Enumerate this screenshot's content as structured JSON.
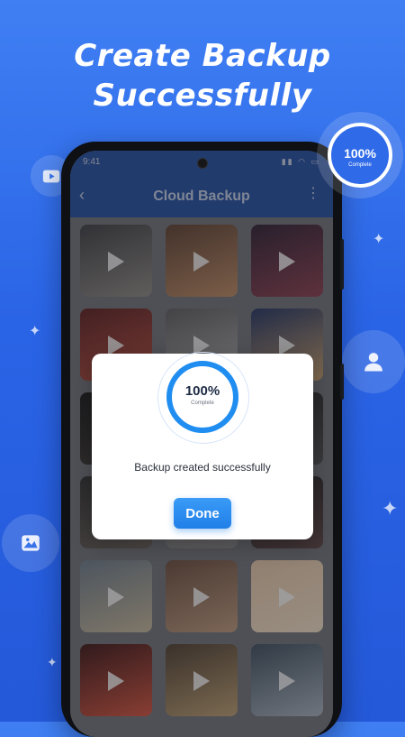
{
  "headline": {
    "line1": "Create Backup",
    "line2": "Successfully"
  },
  "badge": {
    "percent": "100%",
    "label": "Complete",
    "progress": 1.0
  },
  "status_bar": {
    "time": "9:41",
    "icons": "▮▮ ◠ ▭"
  },
  "app_bar": {
    "title": "Cloud Backup",
    "back_icon": "‹",
    "more_icon": "⋮"
  },
  "gallery": {
    "tiles": [
      {
        "name": "photographer",
        "colors": [
          "#3a3a3e",
          "#8e8a84"
        ]
      },
      {
        "name": "musician",
        "colors": [
          "#5a3c2c",
          "#c08a60"
        ]
      },
      {
        "name": "concert-crowd",
        "colors": [
          "#2a1a2e",
          "#8a3a4a"
        ]
      },
      {
        "name": "theater-seats",
        "colors": [
          "#5a1a1a",
          "#b84a3a"
        ]
      },
      {
        "name": "bw-portrait",
        "colors": [
          "#5a5a5a",
          "#b0b0b0"
        ]
      },
      {
        "name": "sunset-sky",
        "colors": [
          "#1e2f5e",
          "#c9a06a"
        ]
      },
      {
        "name": "dark-scene",
        "colors": [
          "#111",
          "#3a3530"
        ]
      },
      {
        "name": "hidden-1",
        "colors": [
          "#777",
          "#888"
        ]
      },
      {
        "name": "dark-scene-2",
        "colors": [
          "#1a1a1a",
          "#4a4a4a"
        ]
      },
      {
        "name": "beach-silhouette",
        "colors": [
          "#2a2a2a",
          "#6a6058"
        ]
      },
      {
        "name": "hidden-2",
        "colors": [
          "#777",
          "#888"
        ]
      },
      {
        "name": "couple-dusk",
        "colors": [
          "#1a1a1a",
          "#5a4040"
        ]
      },
      {
        "name": "picnic-lake",
        "colors": [
          "#6a7a88",
          "#c8b89a"
        ]
      },
      {
        "name": "couple-closeup",
        "colors": [
          "#6a4a3a",
          "#c09a7a"
        ]
      },
      {
        "name": "couple-dance",
        "colors": [
          "#e8c8a8",
          "#f5e2c8"
        ]
      },
      {
        "name": "red-sunset-couple",
        "colors": [
          "#3a1010",
          "#d8503a"
        ]
      },
      {
        "name": "room-silhouette",
        "colors": [
          "#4a3a2a",
          "#c0a070"
        ]
      },
      {
        "name": "mountain-lake",
        "colors": [
          "#3a4a5a",
          "#a8b4c0"
        ]
      }
    ]
  },
  "dialog": {
    "percent": "100%",
    "label": "Complete",
    "progress": 1.0,
    "message": "Backup created successfully",
    "button": "Done"
  },
  "colors": {
    "accent": "#1f7fe8",
    "background": "#2f6ae8"
  }
}
